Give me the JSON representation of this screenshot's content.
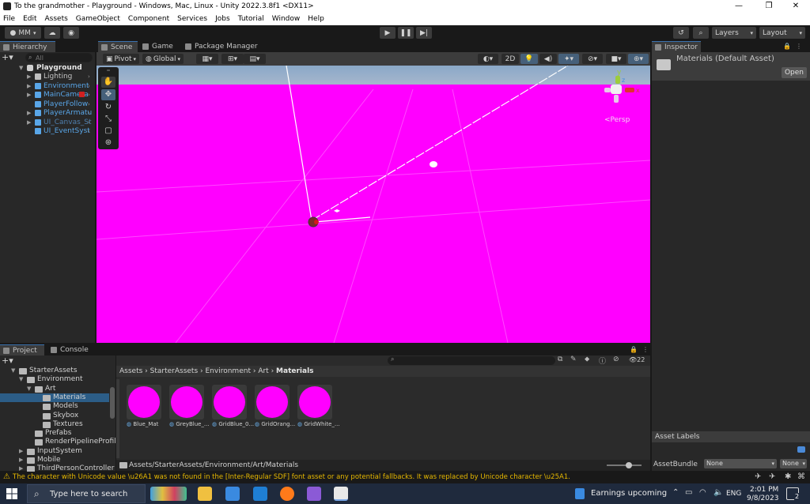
{
  "window": {
    "title": "To the grandmother - Playground - Windows, Mac, Linux - Unity 2022.3.8f1 <DX11>",
    "controls": [
      "—",
      "❐",
      "✕"
    ]
  },
  "menu": [
    "File",
    "Edit",
    "Assets",
    "GameObject",
    "Component",
    "Services",
    "Jobs",
    "Tutorial",
    "Window",
    "Help"
  ],
  "toolbar": {
    "account": "MM",
    "layers": "Layers",
    "layout": "Layout"
  },
  "hierarchy": {
    "tab": "Hierarchy",
    "search_placeholder": "All",
    "scene": "Playground",
    "items": [
      {
        "label": "Lighting",
        "color": "#c4c4c4"
      },
      {
        "label": "Environment",
        "color": "#59a6e8"
      },
      {
        "label": "MainCamera",
        "color": "#59a6e8"
      },
      {
        "label": "PlayerFollow",
        "color": "#59a6e8"
      },
      {
        "label": "PlayerArmatu",
        "color": "#59a6e8"
      },
      {
        "label": "UI_Canvas_St",
        "color": "#4f7fae"
      },
      {
        "label": "UI_EventSyst",
        "color": "#59a6e8"
      }
    ]
  },
  "scene": {
    "tabs": [
      "Scene",
      "Game",
      "Package Manager"
    ],
    "pivot": "Pivot",
    "global": "Global",
    "mode_2d": "2D",
    "persp_label": "<Persp",
    "gizmo_axes": {
      "y": "y",
      "x": "x",
      "z": "z"
    }
  },
  "inspector": {
    "tab": "Inspector",
    "title": "Materials (Default Asset)",
    "open_label": "Open",
    "asset_labels": "Asset Labels",
    "asset_bundle_label": "AssetBundle",
    "asset_bundle_value": "None",
    "asset_bundle_variant": "None"
  },
  "project": {
    "tabs": [
      "Project",
      "Console"
    ],
    "tree": [
      {
        "label": "StarterAssets",
        "depth": 1
      },
      {
        "label": "Environment",
        "depth": 2
      },
      {
        "label": "Art",
        "depth": 3
      },
      {
        "label": "Materials",
        "depth": 4
      },
      {
        "label": "Models",
        "depth": 4
      },
      {
        "label": "Skybox",
        "depth": 4
      },
      {
        "label": "Textures",
        "depth": 4
      },
      {
        "label": "Prefabs",
        "depth": 3
      },
      {
        "label": "RenderPipelineProfile",
        "depth": 3
      },
      {
        "label": "InputSystem",
        "depth": 2
      },
      {
        "label": "Mobile",
        "depth": 2
      },
      {
        "label": "ThirdPersonController",
        "depth": 2
      }
    ],
    "breadcrumb": [
      "Assets",
      "StarterAssets",
      "Environment",
      "Art",
      "Materials"
    ],
    "count": "22",
    "assets": [
      "Blue_Mat",
      "GreyBlue_...",
      "GridBlue_0...",
      "GridOrang...",
      "GridWhite_..."
    ],
    "path": "Assets/StarterAssets/Environment/Art/Materials"
  },
  "console": {
    "warning": "The character with Unicode value \\u26A1 was not found in the [Inter-Regular SDF] font asset or any potential fallbacks. It was replaced by Unicode character \\u25A1."
  },
  "taskbar": {
    "search_placeholder": "Type here to search",
    "news": "Earnings upcoming",
    "lang": "ENG",
    "time": "2:01 PM",
    "date": "9/8/2023",
    "notif_count": "2"
  },
  "colors": {
    "accent": "#3a72b0",
    "magenta": "#ff00ff",
    "warning": "#e6b800"
  }
}
